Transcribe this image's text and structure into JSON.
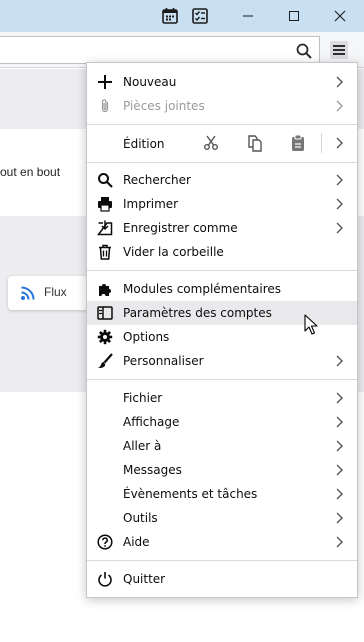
{
  "window": {
    "toolbar_icons": [
      "calendar-icon",
      "tasks-icon"
    ],
    "controls": [
      "minimize-icon",
      "maximize-icon",
      "close-icon"
    ]
  },
  "background": {
    "partial_text": "out en bout",
    "feed_label": "Flux"
  },
  "app_menu": {
    "group1": [
      {
        "label": "Nouveau",
        "icon": "plus-icon",
        "submenu": true,
        "disabled": false
      },
      {
        "label": "Pièces jointes",
        "icon": "paperclip-icon",
        "submenu": true,
        "disabled": true
      }
    ],
    "edit": {
      "label": "Édition",
      "actions": [
        "cut-icon",
        "copy-icon",
        "paste-icon"
      ],
      "submenu": true
    },
    "group2": [
      {
        "label": "Rechercher",
        "icon": "search-icon",
        "submenu": true
      },
      {
        "label": "Imprimer",
        "icon": "printer-icon",
        "submenu": true
      },
      {
        "label": "Enregistrer comme",
        "icon": "save-icon",
        "submenu": true
      },
      {
        "label": "Vider la corbeille",
        "icon": "trash-icon",
        "submenu": false
      }
    ],
    "group3": [
      {
        "label": "Modules complémentaires",
        "icon": "puzzle-icon",
        "submenu": false
      },
      {
        "label": "Paramètres des comptes",
        "icon": "account-settings-icon",
        "submenu": false,
        "hovered": true
      },
      {
        "label": "Options",
        "icon": "gear-icon",
        "submenu": false
      },
      {
        "label": "Personnaliser",
        "icon": "brush-icon",
        "submenu": true
      }
    ],
    "group4": [
      {
        "label": "Fichier",
        "submenu": true
      },
      {
        "label": "Affichage",
        "submenu": true
      },
      {
        "label": "Aller à",
        "submenu": true
      },
      {
        "label": "Messages",
        "submenu": true
      },
      {
        "label": "Évènements et tâches",
        "submenu": true
      },
      {
        "label": "Outils",
        "submenu": true
      },
      {
        "label": "Aide",
        "icon": "help-icon",
        "submenu": true
      }
    ],
    "quit": {
      "label": "Quitter",
      "icon": "power-icon"
    }
  }
}
